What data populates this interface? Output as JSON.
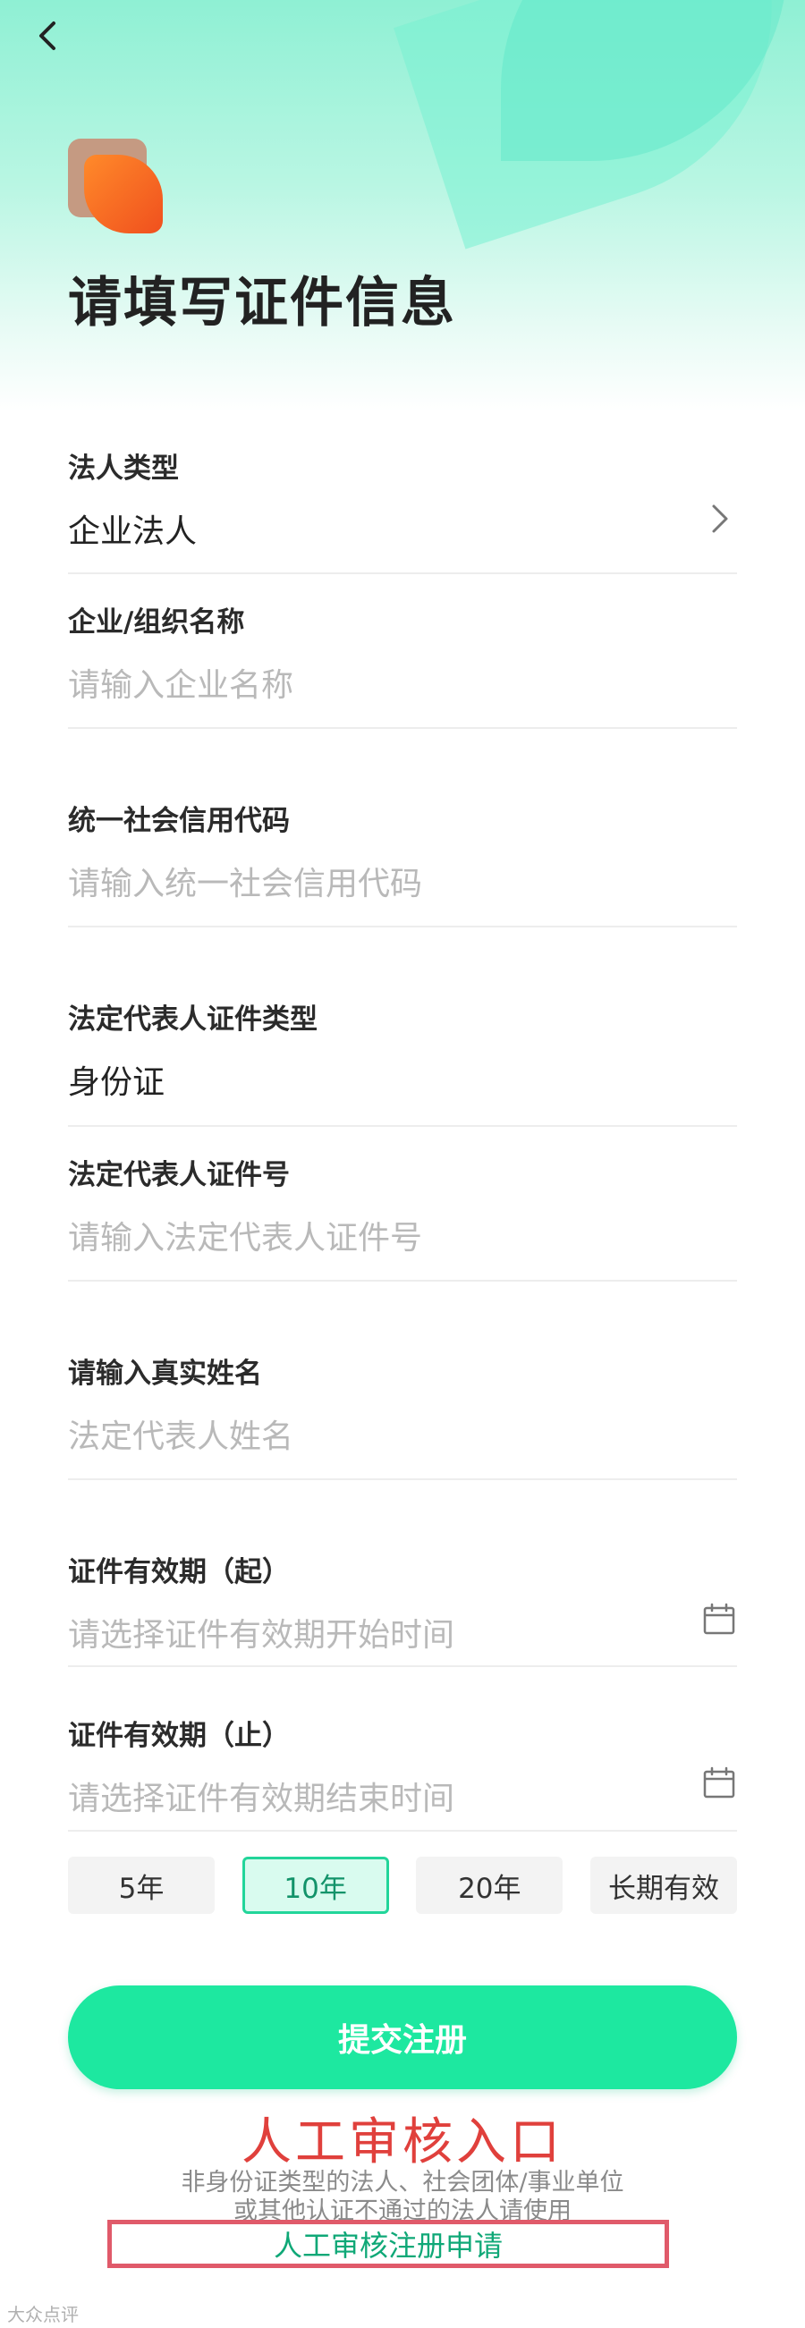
{
  "header": {
    "title": "请填写证件信息"
  },
  "form": {
    "legal_type": {
      "label": "法人类型",
      "value": "企业法人"
    },
    "org_name": {
      "label": "企业/组织名称",
      "placeholder": "请输入企业名称"
    },
    "credit_code": {
      "label": "统一社会信用代码",
      "placeholder": "请输入统一社会信用代码"
    },
    "rep_id_type": {
      "label": "法定代表人证件类型",
      "value": "身份证"
    },
    "rep_id_no": {
      "label": "法定代表人证件号",
      "placeholder": "请输入法定代表人证件号"
    },
    "real_name": {
      "label": "请输入真实姓名",
      "placeholder": "法定代表人姓名"
    },
    "valid_start": {
      "label": "证件有效期（起）",
      "placeholder": "请选择证件有效期开始时间"
    },
    "valid_end": {
      "label": "证件有效期（止）",
      "placeholder": "请选择证件有效期结束时间"
    }
  },
  "validity_chips": [
    {
      "label": "5年",
      "selected": false
    },
    {
      "label": "10年",
      "selected": true
    },
    {
      "label": "20年",
      "selected": false
    },
    {
      "label": "长期有效",
      "selected": false
    }
  ],
  "submit_label": "提交注册",
  "annotation": {
    "title": "人工审核入口"
  },
  "notes": {
    "line1": "非身份证类型的法人、社会团体/事业单位",
    "line2": "或其他认证不通过的法人请使用"
  },
  "manual_review_label": "人工审核注册申请",
  "watermark": "大众点评",
  "colors": {
    "accent": "#1de8a0",
    "annotation_red": "#e0403c",
    "link_green": "#0fa877"
  }
}
